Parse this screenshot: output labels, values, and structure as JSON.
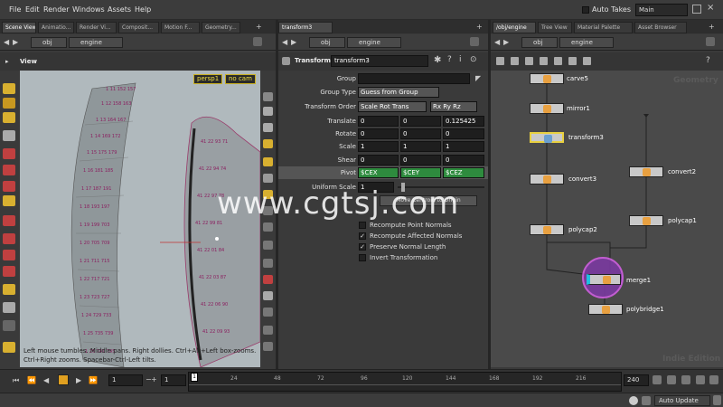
{
  "menubar": {
    "items": [
      "File",
      "Edit",
      "Render",
      "Windows",
      "Assets",
      "Help"
    ],
    "auto_takes": "Auto Takes",
    "desktop": "Main"
  },
  "left_tabs": [
    "Scene View",
    "Animatio...",
    "Render Vi...",
    "Composit...",
    "Motion F...",
    "Geometry..."
  ],
  "mid_tabs": [
    "transform3"
  ],
  "right_tabs": [
    "/obj/engine",
    "Tree View",
    "Material Palette",
    "Asset Browser"
  ],
  "path": {
    "obj": "obj",
    "engine": "engine"
  },
  "viewport": {
    "title": "View",
    "camera": "persp1",
    "cam_menu": "no cam",
    "help_line1": "Left mouse tumbles. Middle pans. Right dollies. Ctrl+Alt+Left box-zooms.",
    "help_line2": "Ctrl+Right zooms. Spacebar-Ctrl-Left tilts."
  },
  "params": {
    "node_type": "Transform",
    "node_name": "transform3",
    "group_label": "Group",
    "group_value": "",
    "group_type_label": "Group Type",
    "group_type_value": "Guess from Group",
    "transform_order_label": "Transform Order",
    "transform_order_value": "Scale Rot Trans",
    "rot_order_value": "Rx Ry Rz",
    "translate_label": "Translate",
    "translate": [
      "0",
      "0",
      "0.125425"
    ],
    "rotate_label": "Rotate",
    "rotate": [
      "0",
      "0",
      "0"
    ],
    "scale_label": "Scale",
    "scale": [
      "1",
      "1",
      "1"
    ],
    "shear_label": "Shear",
    "shear": [
      "0",
      "0",
      "0"
    ],
    "pivot_label": "Pivot",
    "pivot": [
      "$CEX",
      "$CEY",
      "$CEZ"
    ],
    "uniform_scale_label": "Uniform Scale",
    "uniform_scale": "1",
    "move_centroid_button": "Move Centroid to Origin",
    "checkboxes": [
      {
        "label": "Recompute Point Normals",
        "checked": false
      },
      {
        "label": "Recompute Affected Normals",
        "checked": true
      },
      {
        "label": "Preserve Normal Length",
        "checked": true
      },
      {
        "label": "Invert Transformation",
        "checked": false
      }
    ]
  },
  "network": {
    "context_label": "Geometry",
    "edition_label": "Indie Edition",
    "nodes": [
      {
        "name": "carve5"
      },
      {
        "name": "mirror1"
      },
      {
        "name": "transform3"
      },
      {
        "name": "convert3"
      },
      {
        "name": "convert2"
      },
      {
        "name": "polycap1"
      },
      {
        "name": "polycap2"
      },
      {
        "name": "merge1"
      },
      {
        "name": "polybridge1"
      }
    ]
  },
  "timeline": {
    "current_frame": "1",
    "start_frame": "1",
    "end_frame": "240",
    "ticks": [
      "1",
      "24",
      "48",
      "72",
      "96",
      "120",
      "144",
      "168",
      "192",
      "216"
    ],
    "marker_frame": "1"
  },
  "status": {
    "auto_update": "Auto Update"
  },
  "watermark": "www.cgtsj.com"
}
